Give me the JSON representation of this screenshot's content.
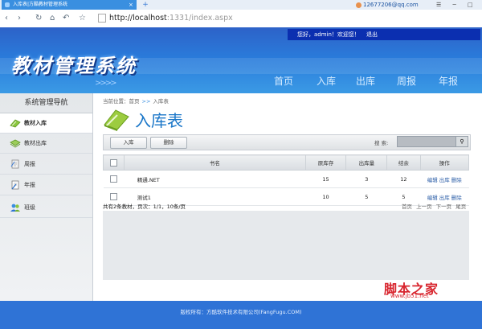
{
  "browser": {
    "tab_title": "入库表|方酷教材管理系统",
    "tab_close": "×",
    "new_tab": "+",
    "user": "12677206@qq.com",
    "window_controls": "☰ ─ □",
    "nav_buttons": [
      "‹",
      "›",
      "↻",
      "⌂",
      "↶",
      "☆"
    ],
    "address_host": "http://localhost",
    "address_rest": ":1331/index.aspx"
  },
  "header": {
    "greeting": "您好，admin！欢迎您！",
    "logout": "退出",
    "logo": "教材管理系统",
    "logo_arrows": ">>>>",
    "nav": [
      "首页",
      "入库",
      "出库",
      "周报",
      "年报"
    ]
  },
  "sidebar": {
    "title": "系统管理导航",
    "items": [
      {
        "label": "教材入库",
        "icon": "book-in-icon",
        "active": true
      },
      {
        "label": "教材出库",
        "icon": "book-out-icon",
        "active": false
      },
      {
        "label": "周报",
        "icon": "weekly-report-icon",
        "active": false
      },
      {
        "label": "年报",
        "icon": "annual-report-icon",
        "active": false
      },
      {
        "label": "班级",
        "icon": "class-group-icon",
        "active": false
      }
    ]
  },
  "content": {
    "breadcrumb_prefix": "当前位置：首页",
    "breadcrumb_sep": ">>",
    "breadcrumb_current": "入库表",
    "page_title": "入库表",
    "toolbar": {
      "add_label": "入库",
      "delete_label": "删除",
      "search_label": "搜 索:"
    },
    "table": {
      "columns": [
        "",
        "书名",
        "原库存",
        "出库量",
        "结余",
        "操作"
      ],
      "rows": [
        {
          "name": "精通.NET",
          "stock": "15",
          "out": "3",
          "balance": "12"
        },
        {
          "name": "测试1",
          "stock": "10",
          "out": "5",
          "balance": "5"
        }
      ],
      "actions": [
        "编辑",
        "出库",
        "删除"
      ]
    },
    "pager_info": "共有2条教材，页次：1/1，10条/页",
    "pager": [
      "首页",
      "上一页",
      "下一页",
      "尾页"
    ]
  },
  "footer": {
    "copyright": "版权所有：方酷软件技术有限公司(FangFugu.COM)"
  },
  "watermark": {
    "text": "脚本之家",
    "url": "www.jb51.net"
  },
  "colors": {
    "header_blue": "#2a7ddc",
    "top_strip": "#0b2fb0",
    "title_blue": "#1a76c8",
    "icon_green": "#8cc63f",
    "footer_blue": "#2f73d6",
    "watermark_red": "#d8252e"
  }
}
